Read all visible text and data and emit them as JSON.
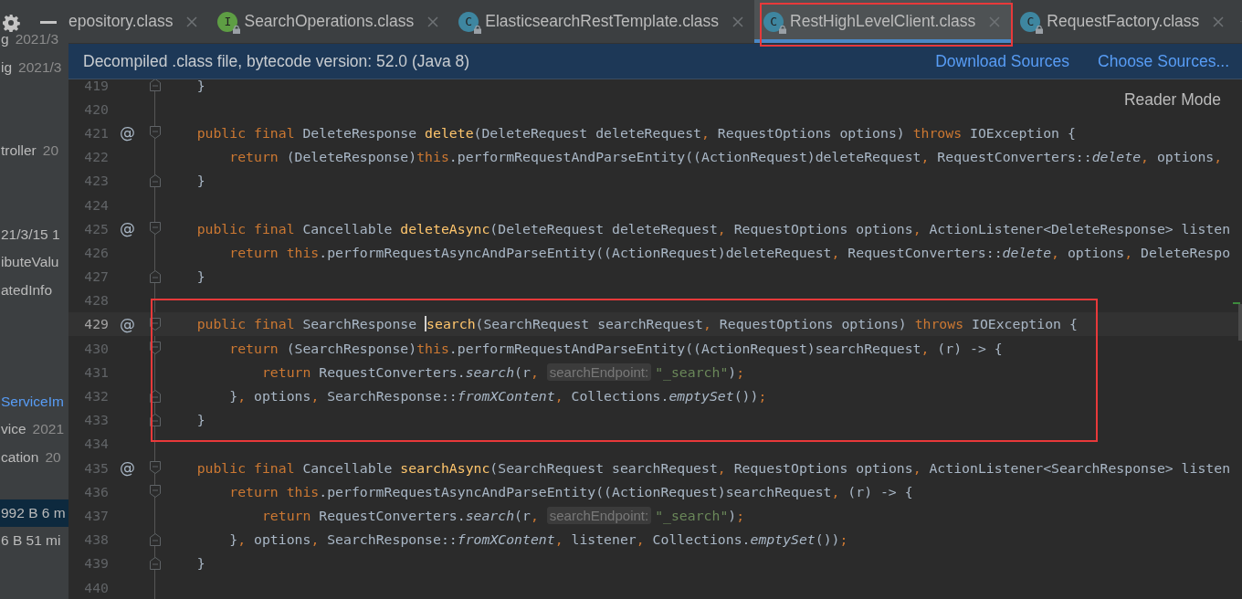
{
  "sidebar": {
    "items": [
      {
        "name": "g",
        "meta": "2021/3",
        "selected": false,
        "modified": false
      },
      {
        "name": "ig",
        "meta": "2021/3",
        "selected": false,
        "modified": false
      },
      {
        "name": "troller",
        "meta": "20",
        "selected": false,
        "modified": false
      },
      {
        "name": "21/3/15 1",
        "selected": false,
        "modified": false
      },
      {
        "name": "ibuteValu",
        "selected": false,
        "modified": false
      },
      {
        "name": "atedInfo",
        "selected": false,
        "modified": false
      },
      {
        "name": "ServiceIm",
        "selected": false,
        "modified": true
      },
      {
        "name": "vice",
        "meta": "2021",
        "selected": false,
        "modified": false
      },
      {
        "name": "cation",
        "meta": "20",
        "selected": false,
        "modified": false
      },
      {
        "name": "992 B 6 m",
        "selected": true,
        "modified": false
      },
      {
        "name": "6 B 51 mi",
        "selected": false,
        "modified": false
      }
    ]
  },
  "tabs": [
    {
      "label": "epository.class",
      "selected": false,
      "outlined": false
    },
    {
      "label": "SearchOperations.class",
      "kind": "interface",
      "letter": "I",
      "selected": false,
      "outlined": false
    },
    {
      "label": "ElasticsearchRestTemplate.class",
      "kind": "class",
      "letter": "C",
      "selected": false,
      "outlined": false
    },
    {
      "label": "RestHighLevelClient.class",
      "kind": "class",
      "letter": "C",
      "selected": true,
      "outlined": true
    },
    {
      "label": "RequestFactory.class",
      "kind": "class",
      "letter": "C",
      "selected": false,
      "outlined": false
    }
  ],
  "banner": {
    "text": "Decompiled .class file, bytecode version: 52.0 (Java 8)",
    "links": [
      "Download Sources",
      "Choose Sources..."
    ]
  },
  "reader_mode": "Reader Mode",
  "lines": [
    {
      "number": "419",
      "fold_start": false,
      "fold_end": true,
      "current": false,
      "outlined": false,
      "tokens": [
        {
          "kind": "plain",
          "text": "    }"
        }
      ]
    },
    {
      "number": "420",
      "fold_start": false,
      "fold_end": false,
      "current": false,
      "outlined": false
    },
    {
      "number": "421",
      "mark": "@",
      "fold_start": true,
      "fold_end": false,
      "current": false,
      "outlined": false,
      "tokens": [
        {
          "kind": "keyword",
          "text": "    public final "
        },
        {
          "kind": "plain",
          "text": "DeleteResponse "
        },
        {
          "kind": "method",
          "text": "delete"
        },
        {
          "kind": "plain",
          "text": "(DeleteRequest deleteRequest"
        },
        {
          "kind": "punct",
          "text": ", "
        },
        {
          "kind": "plain",
          "text": "RequestOptions options) "
        },
        {
          "kind": "keyword",
          "text": "throws "
        },
        {
          "kind": "plain",
          "text": "IOException {"
        }
      ]
    },
    {
      "number": "422",
      "fold_start": false,
      "fold_end": false,
      "current": false,
      "outlined": false,
      "tokens": [
        {
          "kind": "keyword",
          "text": "        return "
        },
        {
          "kind": "plain",
          "text": "(DeleteResponse)"
        },
        {
          "kind": "keyword",
          "text": "this"
        },
        {
          "kind": "plain",
          "text": ".performRequestAndParseEntity((ActionRequest)deleteRequest"
        },
        {
          "kind": "punct",
          "text": ", "
        },
        {
          "kind": "plain",
          "text": "RequestConverters::"
        },
        {
          "kind": "italic",
          "text": "delete"
        },
        {
          "kind": "punct",
          "text": ", "
        },
        {
          "kind": "plain",
          "text": "options"
        },
        {
          "kind": "punct",
          "text": ","
        }
      ]
    },
    {
      "number": "423",
      "fold_start": false,
      "fold_end": true,
      "current": false,
      "outlined": false,
      "tokens": [
        {
          "kind": "plain",
          "text": "    }"
        }
      ]
    },
    {
      "number": "424",
      "fold_start": false,
      "fold_end": false,
      "current": false,
      "outlined": false
    },
    {
      "number": "425",
      "mark": "@",
      "fold_start": true,
      "fold_end": false,
      "current": false,
      "outlined": false,
      "tokens": [
        {
          "kind": "keyword",
          "text": "    public final "
        },
        {
          "kind": "plain",
          "text": "Cancellable "
        },
        {
          "kind": "method",
          "text": "deleteAsync"
        },
        {
          "kind": "plain",
          "text": "(DeleteRequest deleteRequest"
        },
        {
          "kind": "punct",
          "text": ", "
        },
        {
          "kind": "plain",
          "text": "RequestOptions options"
        },
        {
          "kind": "punct",
          "text": ", "
        },
        {
          "kind": "plain",
          "text": "ActionListener<DeleteResponse> listen"
        }
      ]
    },
    {
      "number": "426",
      "fold_start": false,
      "fold_end": false,
      "current": false,
      "outlined": false,
      "tokens": [
        {
          "kind": "keyword",
          "text": "        return this"
        },
        {
          "kind": "plain",
          "text": ".performRequestAsyncAndParseEntity((ActionRequest)deleteRequest"
        },
        {
          "kind": "punct",
          "text": ", "
        },
        {
          "kind": "plain",
          "text": "RequestConverters::"
        },
        {
          "kind": "italic",
          "text": "delete"
        },
        {
          "kind": "punct",
          "text": ", "
        },
        {
          "kind": "plain",
          "text": "options"
        },
        {
          "kind": "punct",
          "text": ", "
        },
        {
          "kind": "plain",
          "text": "DeleteRespo"
        }
      ]
    },
    {
      "number": "427",
      "fold_start": false,
      "fold_end": true,
      "current": false,
      "outlined": false,
      "tokens": [
        {
          "kind": "plain",
          "text": "    }"
        }
      ]
    },
    {
      "number": "428",
      "fold_start": false,
      "fold_end": false,
      "current": false,
      "outlined": false
    },
    {
      "number": "429",
      "mark": "@",
      "fold_start": true,
      "fold_end": false,
      "current": true,
      "outlined": true,
      "tokens": [
        {
          "kind": "keyword",
          "text": "    public final "
        },
        {
          "kind": "plain",
          "text": "SearchResponse "
        },
        {
          "kind": "method",
          "text": "search",
          "caret": true
        },
        {
          "kind": "plain",
          "text": "(SearchRequest searchRequest"
        },
        {
          "kind": "punct",
          "text": ", "
        },
        {
          "kind": "plain",
          "text": "RequestOptions options) "
        },
        {
          "kind": "keyword",
          "text": "throws "
        },
        {
          "kind": "plain",
          "text": "IOException {"
        }
      ]
    },
    {
      "number": "430",
      "fold_start": true,
      "fold_end": false,
      "current": false,
      "outlined": true,
      "tokens": [
        {
          "kind": "keyword",
          "text": "        return "
        },
        {
          "kind": "plain",
          "text": "(SearchResponse)"
        },
        {
          "kind": "keyword",
          "text": "this"
        },
        {
          "kind": "plain",
          "text": ".performRequestAndParseEntity((ActionRequest)searchRequest"
        },
        {
          "kind": "punct",
          "text": ", "
        },
        {
          "kind": "plain",
          "text": "(r) -> {"
        }
      ]
    },
    {
      "number": "431",
      "fold_start": false,
      "fold_end": false,
      "current": false,
      "outlined": true,
      "tokens": [
        {
          "kind": "keyword",
          "text": "            return "
        },
        {
          "kind": "plain",
          "text": "RequestConverters."
        },
        {
          "kind": "italic",
          "text": "search"
        },
        {
          "kind": "plain",
          "text": "(r"
        },
        {
          "kind": "punct",
          "text": ", "
        },
        {
          "kind": "hint",
          "text": "searchEndpoint:"
        },
        {
          "kind": "string",
          "text": "\"_search\""
        },
        {
          "kind": "plain",
          "text": ")"
        },
        {
          "kind": "punct",
          "text": ";"
        }
      ]
    },
    {
      "number": "432",
      "fold_start": false,
      "fold_end": true,
      "current": false,
      "outlined": true,
      "tokens": [
        {
          "kind": "plain",
          "text": "        }"
        },
        {
          "kind": "punct",
          "text": ", "
        },
        {
          "kind": "plain",
          "text": "options"
        },
        {
          "kind": "punct",
          "text": ", "
        },
        {
          "kind": "plain",
          "text": "SearchResponse::"
        },
        {
          "kind": "italic",
          "text": "fromXContent"
        },
        {
          "kind": "punct",
          "text": ", "
        },
        {
          "kind": "plain",
          "text": "Collections."
        },
        {
          "kind": "italic",
          "text": "emptySet"
        },
        {
          "kind": "plain",
          "text": "())"
        },
        {
          "kind": "punct",
          "text": ";"
        }
      ]
    },
    {
      "number": "433",
      "fold_start": false,
      "fold_end": true,
      "current": false,
      "outlined": true,
      "tokens": [
        {
          "kind": "plain",
          "text": "    }"
        }
      ]
    },
    {
      "number": "434",
      "fold_start": false,
      "fold_end": false,
      "current": false,
      "outlined": false
    },
    {
      "number": "435",
      "mark": "@",
      "fold_start": true,
      "fold_end": false,
      "current": false,
      "outlined": false,
      "tokens": [
        {
          "kind": "keyword",
          "text": "    public final "
        },
        {
          "kind": "plain",
          "text": "Cancellable "
        },
        {
          "kind": "method",
          "text": "searchAsync"
        },
        {
          "kind": "plain",
          "text": "(SearchRequest searchRequest"
        },
        {
          "kind": "punct",
          "text": ", "
        },
        {
          "kind": "plain",
          "text": "RequestOptions options"
        },
        {
          "kind": "punct",
          "text": ", "
        },
        {
          "kind": "plain",
          "text": "ActionListener<SearchResponse> listen"
        }
      ]
    },
    {
      "number": "436",
      "fold_start": true,
      "fold_end": false,
      "current": false,
      "outlined": false,
      "tokens": [
        {
          "kind": "keyword",
          "text": "        return this"
        },
        {
          "kind": "plain",
          "text": ".performRequestAsyncAndParseEntity((ActionRequest)searchRequest"
        },
        {
          "kind": "punct",
          "text": ", "
        },
        {
          "kind": "plain",
          "text": "(r) -> {"
        }
      ]
    },
    {
      "number": "437",
      "fold_start": false,
      "fold_end": false,
      "current": false,
      "outlined": false,
      "tokens": [
        {
          "kind": "keyword",
          "text": "            return "
        },
        {
          "kind": "plain",
          "text": "RequestConverters."
        },
        {
          "kind": "italic",
          "text": "search"
        },
        {
          "kind": "plain",
          "text": "(r"
        },
        {
          "kind": "punct",
          "text": ", "
        },
        {
          "kind": "hint",
          "text": "searchEndpoint:"
        },
        {
          "kind": "string",
          "text": "\"_search\""
        },
        {
          "kind": "plain",
          "text": ")"
        },
        {
          "kind": "punct",
          "text": ";"
        }
      ]
    },
    {
      "number": "438",
      "fold_start": false,
      "fold_end": true,
      "current": false,
      "outlined": false,
      "tokens": [
        {
          "kind": "plain",
          "text": "        }"
        },
        {
          "kind": "punct",
          "text": ", "
        },
        {
          "kind": "plain",
          "text": "options"
        },
        {
          "kind": "punct",
          "text": ", "
        },
        {
          "kind": "plain",
          "text": "SearchResponse::"
        },
        {
          "kind": "italic",
          "text": "fromXContent"
        },
        {
          "kind": "punct",
          "text": ", "
        },
        {
          "kind": "plain",
          "text": "listener"
        },
        {
          "kind": "punct",
          "text": ", "
        },
        {
          "kind": "plain",
          "text": "Collections."
        },
        {
          "kind": "italic",
          "text": "emptySet"
        },
        {
          "kind": "plain",
          "text": "())"
        },
        {
          "kind": "punct",
          "text": ";"
        }
      ]
    },
    {
      "number": "439",
      "fold_start": false,
      "fold_end": true,
      "current": false,
      "outlined": false,
      "tokens": [
        {
          "kind": "plain",
          "text": "    }"
        }
      ]
    },
    {
      "number": "440",
      "fold_start": false,
      "fold_end": false,
      "current": false,
      "outlined": false
    }
  ]
}
